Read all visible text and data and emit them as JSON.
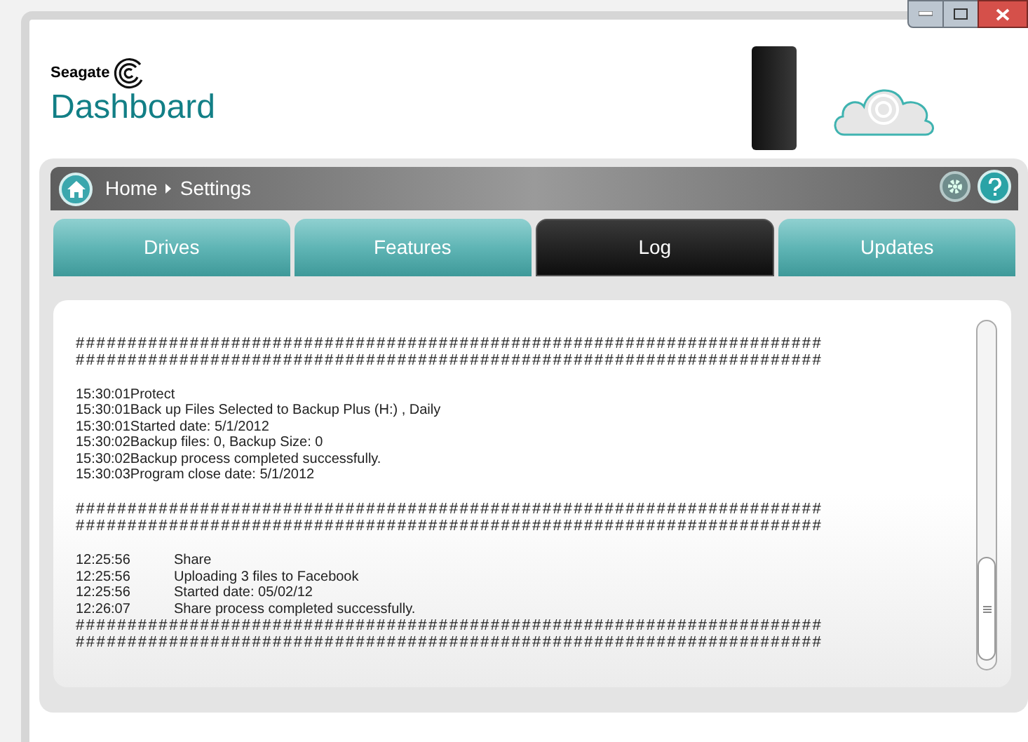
{
  "brand": {
    "company": "Seagate",
    "product": "Dashboard"
  },
  "breadcrumb": [
    "Home",
    "Settings"
  ],
  "tabs": [
    {
      "label": "Drives",
      "selected": false
    },
    {
      "label": "Features",
      "selected": false
    },
    {
      "label": "Log",
      "selected": true
    },
    {
      "label": "Updates",
      "selected": false
    }
  ],
  "log": [
    {
      "kind": "rule",
      "text": "########################################################################"
    },
    {
      "kind": "rule",
      "text": "########################################################################"
    },
    {
      "kind": "blank"
    },
    {
      "kind": "line",
      "text": "15:30:01Protect"
    },
    {
      "kind": "line",
      "text": "15:30:01Back up Files Selected to Backup Plus (H:) , Daily"
    },
    {
      "kind": "line",
      "text": "15:30:01Started date: 5/1/2012"
    },
    {
      "kind": "line",
      "text": "15:30:02Backup files: 0, Backup Size: 0"
    },
    {
      "kind": "line",
      "text": "15:30:02Backup process completed successfully."
    },
    {
      "kind": "line",
      "text": "15:30:03Program close date: 5/1/2012"
    },
    {
      "kind": "blank"
    },
    {
      "kind": "rule",
      "text": "########################################################################"
    },
    {
      "kind": "rule",
      "text": "########################################################################"
    },
    {
      "kind": "blank"
    },
    {
      "kind": "tabbed",
      "time": "12:25:56",
      "text": "Share"
    },
    {
      "kind": "tabbed",
      "time": "12:25:56",
      "text": "Uploading 3 files to Facebook"
    },
    {
      "kind": "tabbed",
      "time": "12:25:56",
      "text": "Started date: 05/02/12"
    },
    {
      "kind": "tabbed",
      "time": "12:26:07",
      "text": "Share process completed successfully."
    },
    {
      "kind": "rule",
      "text": "########################################################################"
    },
    {
      "kind": "rule",
      "text": "########################################################################"
    }
  ]
}
